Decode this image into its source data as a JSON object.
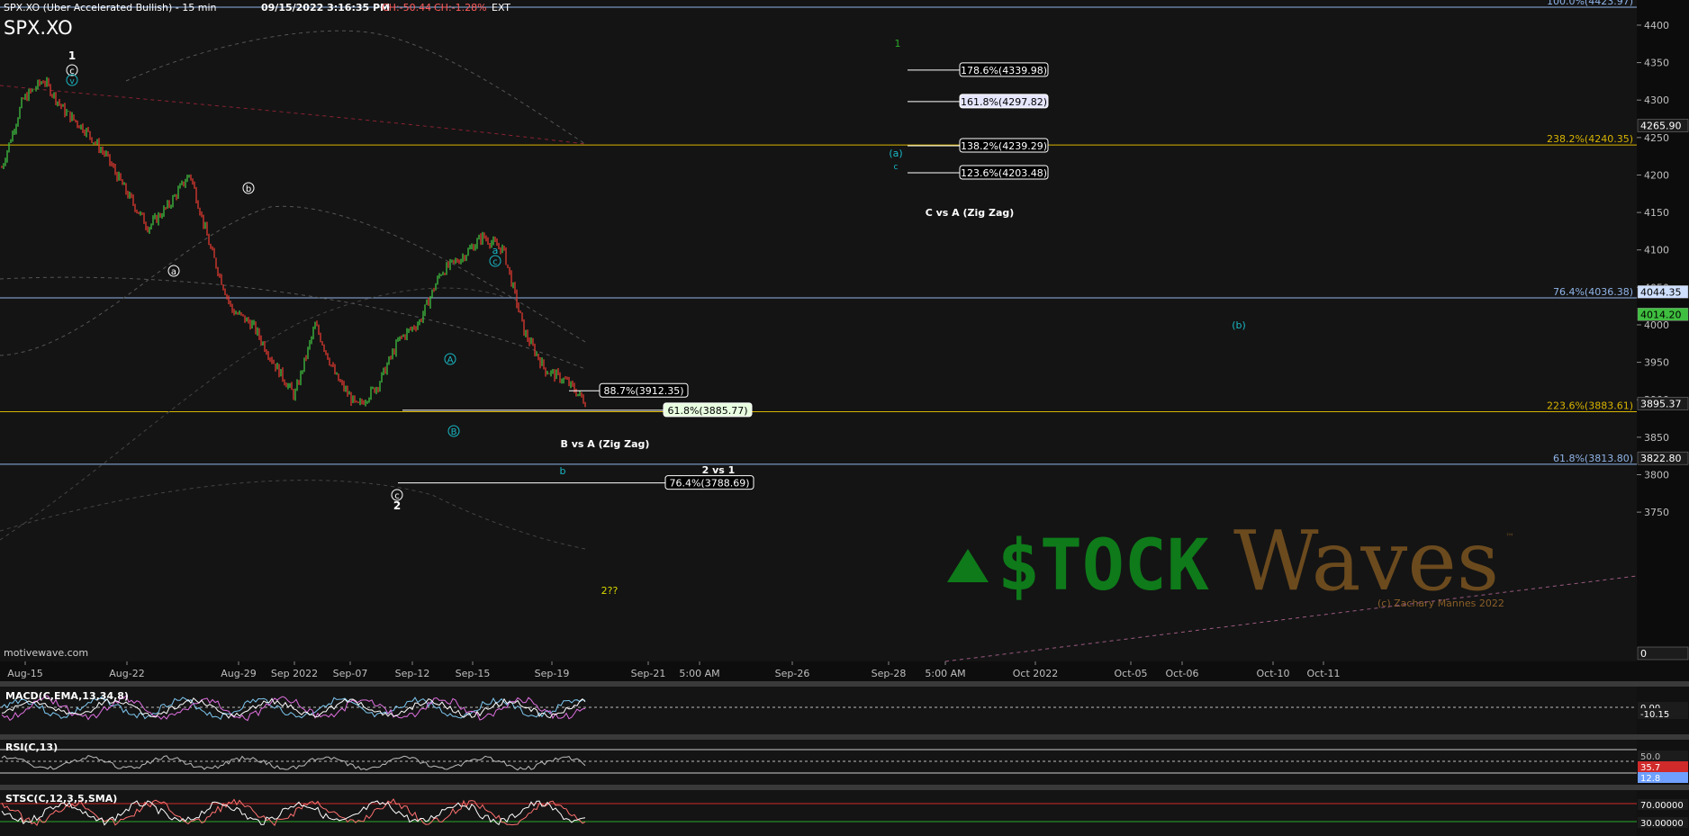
{
  "header": {
    "title_line": "SPX.XO (Uber Accelerated Bullish) - 15 min",
    "datetime": "09/15/2022 3:16:35 PM",
    "change_abs": "CH:-50.44",
    "change_pct": "CH:-1.28%",
    "session": "EXT",
    "symbol": "SPX.XO"
  },
  "watermark": {
    "brand_left": "$TOCK",
    "brand_right": "Waves",
    "tm": "™",
    "copyright": "(c) Zachary Mannes 2022",
    "credit": "motivewave.com"
  },
  "colors": {
    "background": "#111111",
    "up_bar": "#3fbf3f",
    "down_bar": "#e03a2f",
    "yellow_line": "#d8b400",
    "blue_line": "#8fb4e8",
    "cyan_label": "#19b7c4",
    "green_brand": "#0e7a1a",
    "brown_brand": "#6b4a1e",
    "macd": "#e070e0",
    "macd_signal": "#ffffff",
    "macd_hist": "#7ec8f0",
    "rsi": "#bbbbbb",
    "stoch_k": "#ff7070",
    "stoch_d": "#ffffff"
  },
  "chart_data": [
    {
      "type": "line",
      "title": "SPX.XO (Uber Accelerated Bullish) - 15 min",
      "x_axis_labels": [
        "Aug-15",
        "Aug-22",
        "Aug-29",
        "Sep 2022",
        "Sep-07",
        "Sep-12",
        "Sep-15",
        "Sep-19",
        "Sep-21",
        "5:00 AM",
        "Sep-26",
        "Sep-28",
        "5:00 AM",
        "Oct 2022",
        "Oct-05",
        "Oct-06",
        "Oct-10",
        "Oct-11"
      ],
      "y_ticks": [
        4400,
        4350,
        4300,
        4250,
        4200,
        4150,
        4100,
        4050,
        4000,
        3950,
        3900,
        3850,
        3800,
        3750
      ],
      "ylim": [
        3700,
        4430
      ],
      "price_path": [
        {
          "x": "Aug-15",
          "y": 4210
        },
        {
          "x": "Aug-16",
          "y": 4300
        },
        {
          "x": "Aug-17",
          "y": 4327
        },
        {
          "x": "Aug-18",
          "y": 4285
        },
        {
          "x": "Aug-19",
          "y": 4260
        },
        {
          "x": "Aug-21",
          "y": 4225
        },
        {
          "x": "Aug-22",
          "y": 4175
        },
        {
          "x": "Aug-23",
          "y": 4130
        },
        {
          "x": "Aug-25",
          "y": 4160
        },
        {
          "x": "Aug-26",
          "y": 4202
        },
        {
          "x": "Aug-27",
          "y": 4100
        },
        {
          "x": "Aug-29",
          "y": 4020
        },
        {
          "x": "Aug-30",
          "y": 4000
        },
        {
          "x": "Aug-31",
          "y": 3950
        },
        {
          "x": "Sep-01",
          "y": 3905
        },
        {
          "x": "Sep-02",
          "y": 4000
        },
        {
          "x": "Sep-03",
          "y": 3930
        },
        {
          "x": "Sep-05",
          "y": 3890
        },
        {
          "x": "Sep-06",
          "y": 3920
        },
        {
          "x": "Sep-07",
          "y": 3980
        },
        {
          "x": "Sep-08",
          "y": 4005
        },
        {
          "x": "Sep-09",
          "y": 4070
        },
        {
          "x": "Sep-10",
          "y": 4090
        },
        {
          "x": "Sep-12",
          "y": 4118
        },
        {
          "x": "Sep-13",
          "y": 4100
        },
        {
          "x": "Sep-13b",
          "y": 3990
        },
        {
          "x": "Sep-14",
          "y": 3940
        },
        {
          "x": "Sep-15",
          "y": 3925
        },
        {
          "x": "Sep-15b",
          "y": 3895
        }
      ],
      "price_tags": [
        {
          "value": "4265.90",
          "y": 4266
        },
        {
          "value": "4044.35",
          "y": 4044,
          "style": "blue"
        },
        {
          "value": "4014.20",
          "y": 4014,
          "style": "green"
        },
        {
          "value": "3895.37",
          "y": 3895
        },
        {
          "value": "3822.80",
          "y": 3822
        },
        {
          "value": "0",
          "y": 3705
        }
      ],
      "horizontal_levels": [
        {
          "label": "100.0%(4423.97)",
          "y": 4424,
          "color": "blue"
        },
        {
          "label": "238.2%(4240.35)",
          "y": 4240,
          "color": "yellow"
        },
        {
          "label": "76.4%(4036.38)",
          "y": 4036,
          "color": "blue"
        },
        {
          "label": "223.6%(3883.61)",
          "y": 3884,
          "color": "yellow"
        },
        {
          "label": "61.8%(3813.80)",
          "y": 3814,
          "color": "blue"
        }
      ],
      "fib_boxes": [
        {
          "label": "178.6%(4339.98)",
          "y": 4340
        },
        {
          "label": "161.8%(4297.82)",
          "y": 4298,
          "highlight": true
        },
        {
          "label": "138.2%(4239.29)",
          "y": 4239
        },
        {
          "label": "123.6%(4203.48)",
          "y": 4203
        },
        {
          "label": "88.7%(3912.35)",
          "y": 3912
        },
        {
          "label": "61.8%(3885.77)",
          "y": 3886,
          "highlight": true
        },
        {
          "label": "76.4%(3788.69)",
          "y": 3789
        }
      ],
      "annotations": [
        {
          "text": "C vs A (Zig Zag)"
        },
        {
          "text": "B vs A (Zig Zag)"
        },
        {
          "text": "2 vs 1"
        },
        {
          "text": "2??"
        },
        {
          "text": "1"
        },
        {
          "text": "c"
        },
        {
          "text": "v"
        },
        {
          "text": "b"
        },
        {
          "text": "a"
        },
        {
          "text": "a"
        },
        {
          "text": "c"
        },
        {
          "text": "A"
        },
        {
          "text": "B"
        },
        {
          "text": "b"
        },
        {
          "text": "c"
        },
        {
          "text": "2"
        },
        {
          "text": "(a)"
        },
        {
          "text": "c"
        },
        {
          "text": "(b)"
        },
        {
          "text": "1"
        }
      ]
    },
    {
      "type": "line",
      "title": "MACD(C,EMA,13,34,8)",
      "value_tags": [
        "0.00",
        "-10.15"
      ],
      "series": [
        {
          "name": "MACD"
        },
        {
          "name": "Signal"
        }
      ]
    },
    {
      "type": "line",
      "title": "RSI(C,13)",
      "value_tags": [
        "50.0",
        "35.7",
        "12.8"
      ]
    },
    {
      "type": "line",
      "title": "STSC(C,12,3,5,SMA)",
      "value_tags": [
        "70.00000",
        "30.00000"
      ]
    }
  ]
}
